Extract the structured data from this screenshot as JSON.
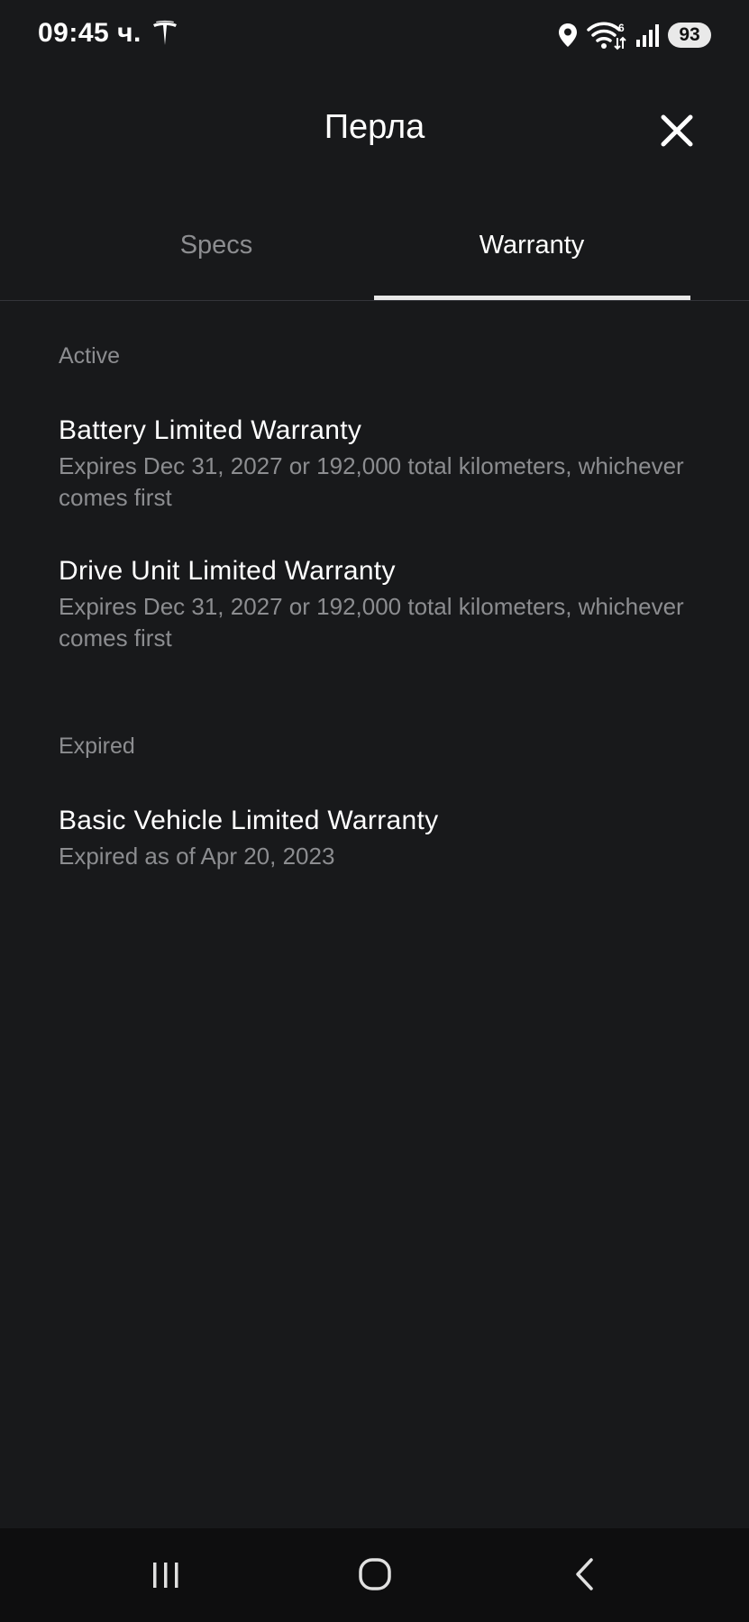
{
  "status_bar": {
    "time": "09:45 ч.",
    "battery": "93",
    "wifi_badge": "6",
    "icons": [
      "tesla-logo-icon",
      "location-icon",
      "wifi-icon",
      "signal-icon",
      "battery-icon"
    ]
  },
  "header": {
    "title": "Перла",
    "close_icon": "close-icon"
  },
  "tabs": [
    {
      "label": "Specs",
      "active": false
    },
    {
      "label": "Warranty",
      "active": true
    }
  ],
  "sections": {
    "active": {
      "label": "Active",
      "items": [
        {
          "title": "Battery Limited Warranty",
          "subtitle": "Expires Dec 31, 2027 or 192,000 total kilometers, whichever comes first"
        },
        {
          "title": "Drive Unit Limited Warranty",
          "subtitle": "Expires Dec 31, 2027 or 192,000 total kilometers, whichever comes first"
        }
      ]
    },
    "expired": {
      "label": "Expired",
      "items": [
        {
          "title": "Basic Vehicle Limited Warranty",
          "subtitle": "Expired as of Apr 20, 2023"
        }
      ]
    }
  },
  "nav": {
    "icons": [
      "recent-apps-icon",
      "home-icon",
      "back-icon"
    ]
  },
  "colors": {
    "background": "#18191b",
    "text_primary": "#ffffff",
    "text_secondary": "#8c8d90",
    "tab_underline": "#e8e8e8"
  }
}
